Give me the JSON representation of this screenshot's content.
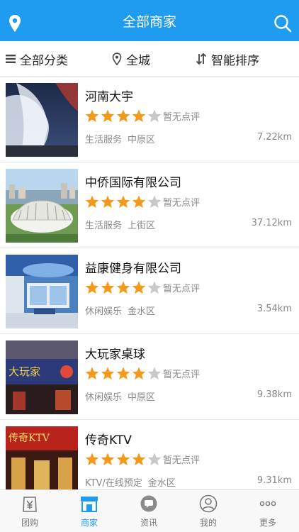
{
  "header": {
    "title": "全部商家"
  },
  "filters": [
    {
      "label": "全部分类"
    },
    {
      "label": "全城"
    },
    {
      "label": "智能排序"
    }
  ],
  "merchants": [
    {
      "name": "河南大宇",
      "rating": 4,
      "review_text": "暂无点评",
      "category": "生活服务",
      "district": "中原区",
      "distance": "7.22km"
    },
    {
      "name": "中侨国际有限公司",
      "rating": 4,
      "review_text": "暂无点评",
      "category": "生活服务",
      "district": "上街区",
      "distance": "37.12km"
    },
    {
      "name": "益康健身有限公司",
      "rating": 4,
      "review_text": "暂无点评",
      "category": "休闲娱乐",
      "district": "金水区",
      "distance": "3.54km"
    },
    {
      "name": "大玩家桌球",
      "rating": 4,
      "review_text": "暂无点评",
      "category": "休闲娱乐",
      "district": "中原区",
      "distance": "9.38km"
    },
    {
      "name": "传奇KTV",
      "rating": 4,
      "review_text": "暂无点评",
      "category": "KTV/在线预定",
      "district": "金水区",
      "distance": "9.31km"
    }
  ],
  "thumb_text": {
    "shop3": "大玩家",
    "shop4": "传奇KTV"
  },
  "tabbar": [
    {
      "label": "团购",
      "icon": "yuan-bag-icon",
      "active": false
    },
    {
      "label": "商家",
      "icon": "shop-icon",
      "active": true
    },
    {
      "label": "资讯",
      "icon": "chat-icon",
      "active": false
    },
    {
      "label": "我的",
      "icon": "user-icon",
      "active": false
    },
    {
      "label": "更多",
      "icon": "more-dots-icon",
      "active": false
    }
  ],
  "colors": {
    "accent": "#1f9bf0",
    "star_on": "#f39a1c",
    "star_off": "#c8c8c8"
  }
}
